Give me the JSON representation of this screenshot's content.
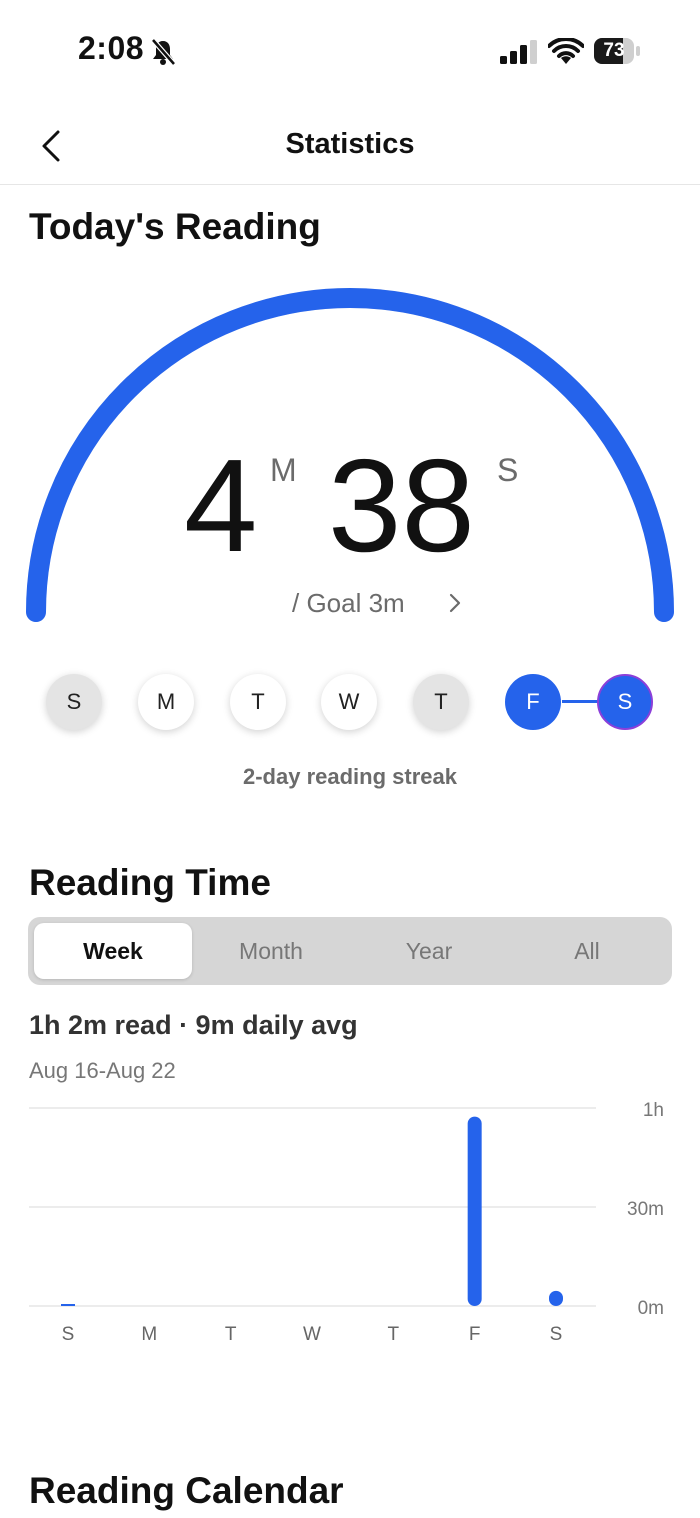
{
  "status_bar": {
    "time": "2:08",
    "battery": "73",
    "battery_level": 0.73
  },
  "nav": {
    "title": "Statistics"
  },
  "today": {
    "heading": "Today's Reading",
    "minutes": "4",
    "minutes_unit": "M",
    "seconds": "38",
    "seconds_unit": "S",
    "goal_text": "/ Goal 3m",
    "progress_fraction": 1.0,
    "accent_color": "#2563eb"
  },
  "streak": {
    "days": [
      {
        "label": "S",
        "state": "missed"
      },
      {
        "label": "M",
        "state": "none"
      },
      {
        "label": "T",
        "state": "none"
      },
      {
        "label": "W",
        "state": "none"
      },
      {
        "label": "T",
        "state": "missed"
      },
      {
        "label": "F",
        "state": "read"
      },
      {
        "label": "S",
        "state": "read-today"
      }
    ],
    "text": "2-day reading streak"
  },
  "reading_time": {
    "heading": "Reading Time",
    "tabs": [
      "Week",
      "Month",
      "Year",
      "All"
    ],
    "active_tab": "Week",
    "summary": "1h 2m read · 9m daily avg",
    "range": "Aug 16-Aug 22"
  },
  "chart_data": {
    "type": "bar",
    "categories": [
      "S",
      "M",
      "T",
      "W",
      "T",
      "F",
      "S"
    ],
    "values": [
      0.2,
      0,
      0,
      0,
      0,
      57.4,
      4.6
    ],
    "ylim": [
      0,
      60
    ],
    "y_ticks": [
      {
        "value": 60,
        "label": "1h"
      },
      {
        "value": 30,
        "label": "30m"
      },
      {
        "value": 0,
        "label": "0m"
      }
    ],
    "ylabel": "",
    "xlabel": "",
    "grid": true,
    "color": "#2563eb"
  },
  "calendar": {
    "heading": "Reading Calendar"
  }
}
